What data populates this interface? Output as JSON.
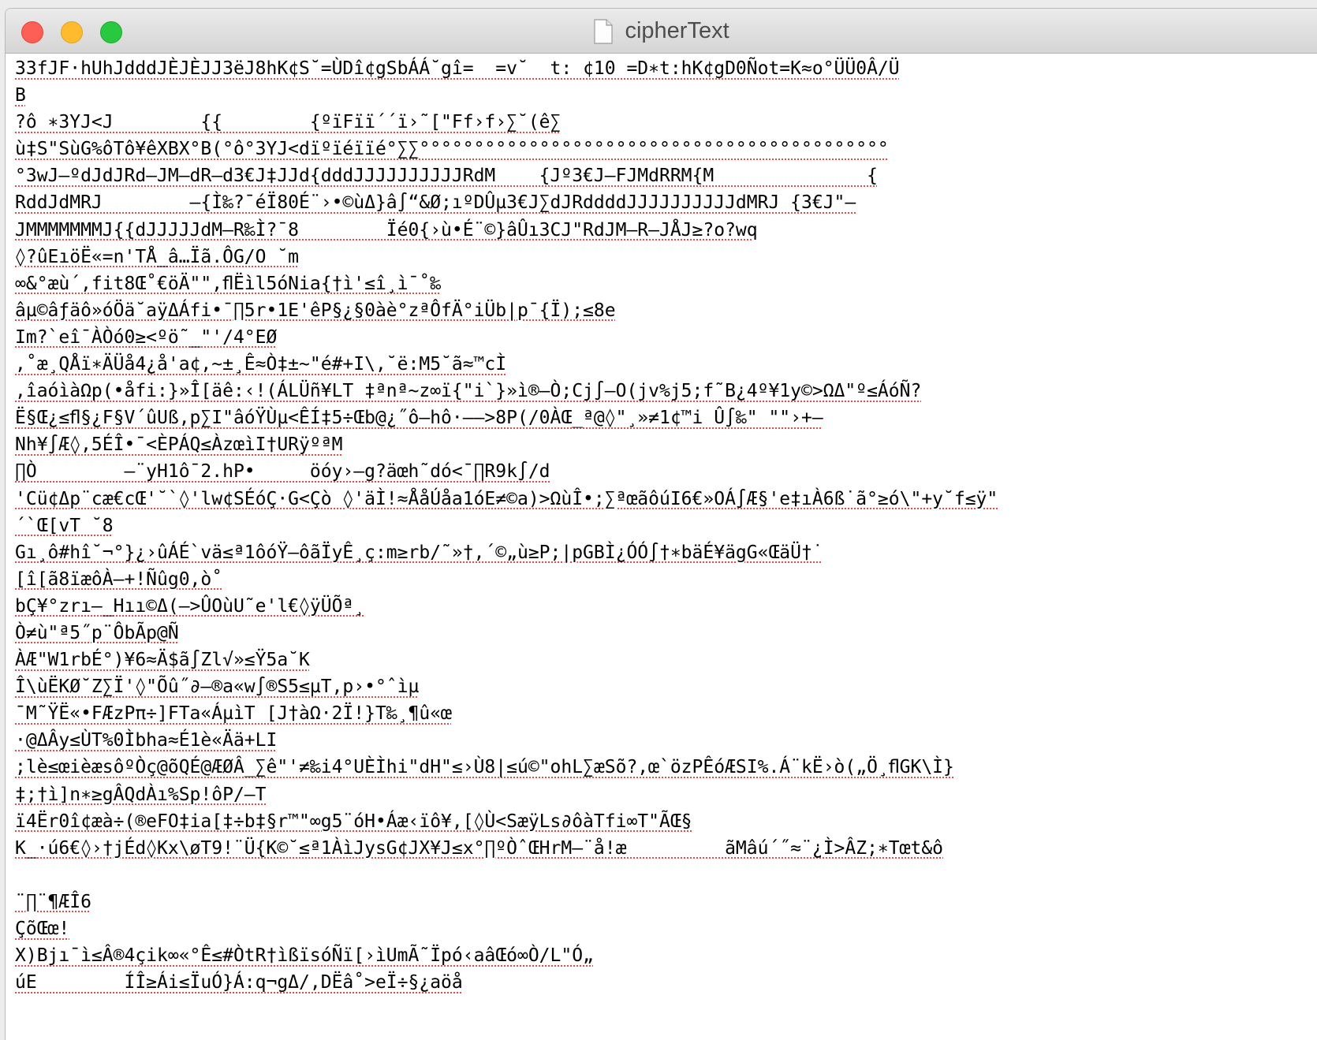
{
  "window": {
    "title": "cipherText",
    "doc_icon": "document-icon"
  },
  "document": {
    "lines": [
      "33fJF·hUhJdddJÈJÈJJ3ëJ8hK¢S˘=ÙDî¢gSbÁÁ˘gî=  =v˘  t: ¢10 =D∗t:hK¢gD0Ñot=K≈o°ÜÜ0Â/Ü",
      "B",
      "?ô ∗3YJ<J        {{        {ºïFïï´´ï›˜[\"Ff›f›∑˘(ê∑",
      "ù‡S\"SùG%ôTô¥êXBX°B(°ô°3YJ<dïºïéïïé°∑∑°°°°°°°°°°°°°°°°°°°°°°°°°°°°°°°°°°°°°°°°°°°",
      "°3wJ–ºdJdJRd–JM–dR–d3€J‡JJd{dddJJJJJJJJJJRdM    {Jº3€J–FJMdRRM{M              {",
      "RddJdMRJ        –{Ì‰?¯éÏ80É¨›•©ùΔ}â∫“&Ø;ıºDÛµ3€J∑dJRddddJJJJJJJJJJdMRJ {3€J\"–",
      "JMMMMMMMJ{{dJJJJJdM–R‰Ì?¯8        Ïé0{›ù•É¨©}âÛı3CJ\"RdJM–R–JÅJ≥?o?wq",
      "◊?ûEıöË«=n'TÅ_â…Ïã.ÔG/O ˘m",
      "∞&°æù´,fit8Œ˚€öÄ\"\",ﬂËìl5óNia{†ì'≤î¸ì¯˚‰",
      "âµ©âƒäô»óÖä˘aÿΔÁfi•¯∏5r•1E'êP§¿§0àè°zªÔfÄ°iÜb|p¯{Ï);≤8e",
      "Im?`eî¯ÀÒó0≥<ºö˜_\"'/4°EØ",
      ",˚æ¸QÅï∗ÄÜå4¿å'a¢,~±¸Ê≈Ò‡±~\"é#+I\\,˘ë:M5˘ã≈™cÌ",
      ",îaóìàΩp(•åfi:}»Î[äê:‹!(ÁLÜñ¥LT ‡ªnª~z∞ï{\"i`}»ì®–Ò;Cj∫–O(jv%j5;f˜B¿4º¥1y©>ΩΔ\"º≤ÁóÑ?",
      "Ë§Œ¿≤ﬂ§¿F§V´ûUß,p∑I\"âóŸÙµ<ÊÍ‡5÷Œb@¿˝ô–hô·—–>8P(/0ÀŒ_ª@◊\"¸»≠1¢™i Û∫‰\" \"\"›+–",
      "Nh¥∫Æ◊,5ÉÎ•¯<ÈPÁQ≤ÀzœìI†URÿºªM",
      "∏Ò        –¨yH1ô¯2.hP•     öóy›–g?äœh˜dó<¯∏R9k∫/d",
      "'Cü¢Δp¨cæ€cŒ'˘`◊'lw¢SÉóÇ·G<Çò ◊'äÌ!≈ÅåÚåa1óE≠©a)>ΩùÎ•;∑ªœãôúI6€»OÁ∫Æ§'e‡ıÀ6ß˙ã°≥ó\\\"+y˘f≤ÿ\"",
      "´`Œ[vT ˘8",
      "Gı¸ô#hî˘¬°}¿›ûÁÉ`vä≤ª1ôóŸ–ôãÏyÊ¸ç:m≥rb/˜»†,´©„ù≥P;|pGBÌ¿ÓÓ∫†∗bäÉ¥ägG«ŒäÜ†˙",
      "[î[ã8ïæôÀ–+!Ñûg0,ò˚",
      "bÇ¥°zrı–_Hıı©Δ(–>ÛOùU˜e'l€◊ÿÜÕª¸",
      "Ò≠ù\"ª5˝p¨ÔbÃp@Ñ",
      "ÀÆ\"W1rbÉ°)¥6≈Ä$ã∫Zl√»≤Ÿ5a˘K",
      "Î\\ùËKØ˘Z∑Ï'◊\"Õû˝∂–®a«w∫®S5≤µT,p›•°ˆìµ",
      "¯M˜ŸË«•FÆzPπ÷]FTa«ÁµìT [J†àΩ·2Ï!}T‰¸¶û«œ",
      "·@ΔÂy≤ÙT%0Ìbha≈É1è«Ää+LI",
      ";lè≤œièæsôºÒç@õQÉ@ÆØÂ_∑ê\"'≠‰i4°UÈÌhi\"dH\"≤›Ù8|≤ú©\"ohL∑æSõ?,œ`özPÊóÆSI%.Á¨kË›ò(„Ö¸ﬂGK\\Ì}",
      "‡;†ì]n∗≥gÂQdÀı%Sp!ôP/–T",
      "ï4Ër0î¢æà÷(®eFO‡ia[‡÷b‡§r™\"∞g5¨óH•Áæ‹ïô¥,[◊Ù<SæÿLs∂ôàTfi∞T\"ÃŒ§",
      "K_·ú6€◊›†jÉd◊Kx\\øT9!¨Ü{K©˘≤ª1ÀìJysG¢JX¥J≤x°∏ºÒˆŒHrM–¨å!æ         ãMâú´˝≈¨¿Ì>ÂZ;∗Tœt&ô",
      "",
      "¨∏¨¶ÆÎ6",
      "ÇõŒœ!",
      "X)Bjı¯ì≤Â®4çik∞«°Ê≤#ÒtR†ìßïsóÑï[›ìUmÃ˜Ïpó‹aâŒó∞Ò/L\"Ó„",
      "úE        ÍÎ≥Ái≤ÏuÓ}Á:q¬gΔ/,DËâ˚>eÏ÷§¿aöå"
    ]
  }
}
